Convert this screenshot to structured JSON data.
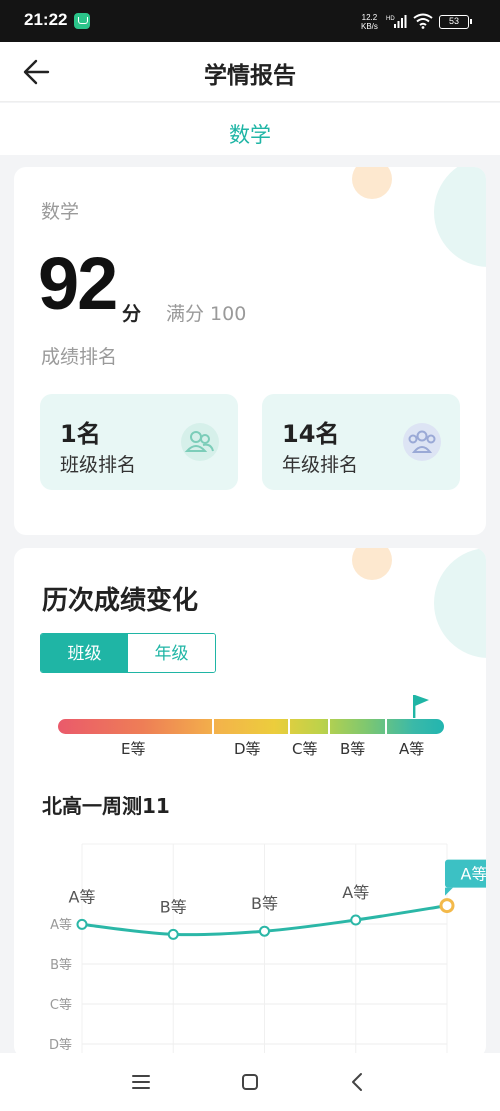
{
  "status_bar": {
    "time": "21:22",
    "net_speed_value": "12.2",
    "net_speed_unit": "KB/s",
    "network_type": "HD",
    "battery": "53"
  },
  "header": {
    "title": "学情报告"
  },
  "subject_tab": {
    "label": "数学"
  },
  "score_card": {
    "subject": "数学",
    "score": "92",
    "score_unit": "分",
    "full_score": "满分 100",
    "rank_heading": "成绩排名",
    "class_rank": {
      "value": "1名",
      "label": "班级排名"
    },
    "grade_rank": {
      "value": "14名",
      "label": "年级排名"
    }
  },
  "history_card": {
    "title": "历次成绩变化",
    "toggle": {
      "class": "班级",
      "grade": "年级",
      "active": "class"
    },
    "grade_scale": [
      "E等",
      "D等",
      "C等",
      "B等",
      "A等"
    ],
    "current_grade": "A等",
    "exam_name": "北高一周测11"
  },
  "chart_data": {
    "type": "line",
    "title": "",
    "xlabel": "",
    "ylabel": "",
    "y_categories": [
      "A等",
      "B等",
      "C等",
      "D等"
    ],
    "points": [
      {
        "label": "A等",
        "value": 0.99
      },
      {
        "label": "B等",
        "value": 0.74
      },
      {
        "label": "B等",
        "value": 0.82
      },
      {
        "label": "A等",
        "value": 1.1
      },
      {
        "label": "A等",
        "value": 1.46
      }
    ],
    "highlight_label": "A等",
    "colors": {
      "line": "#2bb7a7",
      "highlight": "#f3b94a",
      "badge": "#3cc1c4"
    }
  },
  "nav_bar": {
    "menu": "menu",
    "home": "home",
    "back": "back"
  },
  "colors": {
    "accent": "#1fb5a5",
    "rank_bg": "#e8f7f5"
  }
}
